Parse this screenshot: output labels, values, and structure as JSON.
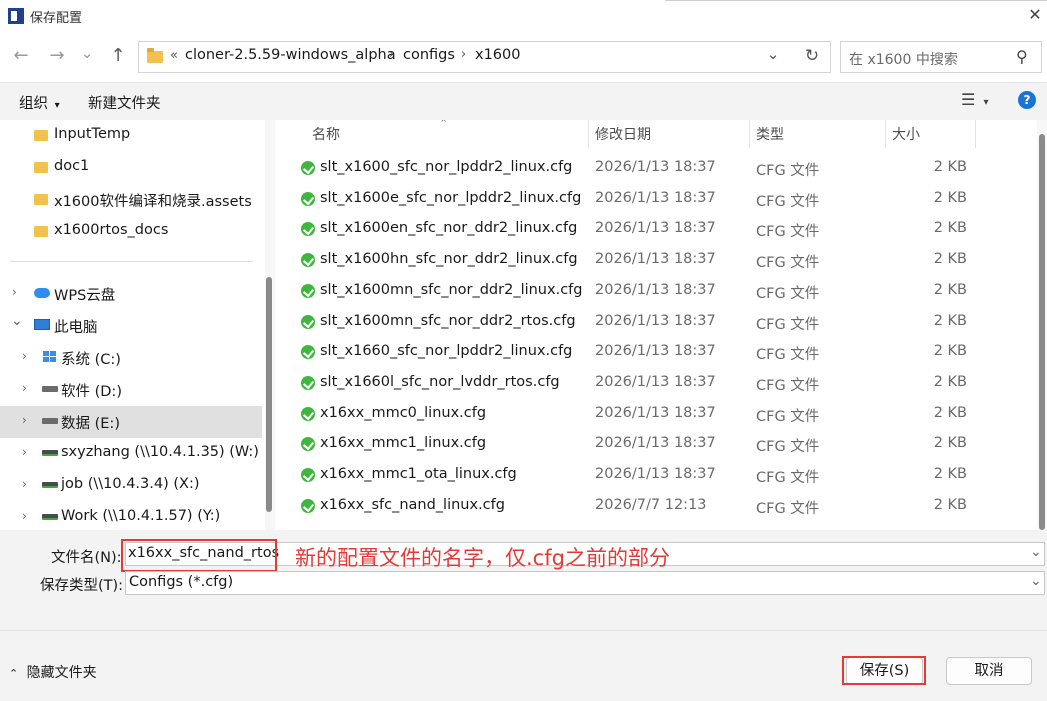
{
  "window": {
    "title": "保存配置",
    "close_glyph": "✕"
  },
  "nav": {
    "back_glyph": "←",
    "forward_glyph": "→",
    "recent_glyph": "⌄",
    "up_glyph": "↑",
    "overflow_glyph": "«",
    "breadcrumb": [
      "cloner-2.5.59-windows_alpha",
      "configs",
      "x1600"
    ],
    "crumb_sep": "›",
    "dropdown_glyph": "⌄",
    "refresh_glyph": "↻",
    "search_placeholder": "在 x1600 中搜索",
    "search_glyph": "⚲"
  },
  "commands": {
    "organize": "组织",
    "organize_caret": "▾",
    "new_folder": "新建文件夹",
    "view_glyph": "☰",
    "view_caret": "▾",
    "help_glyph": "?"
  },
  "tree": {
    "folders": [
      "InputTemp",
      "doc1",
      "x1600软件编译和烧录.assets",
      "x1600rtos_docs"
    ],
    "chev_right": "›",
    "chev_down": "⌄",
    "wps": "WPS云盘",
    "this_pc": "此电脑",
    "drives": [
      {
        "label": "系统 (C:)",
        "icon": "windows-drive-icon"
      },
      {
        "label": "软件 (D:)",
        "icon": "drive-icon"
      },
      {
        "label": "数据 (E:)",
        "icon": "drive-icon",
        "selected": true
      },
      {
        "label": "sxyzhang (\\\\10.4.1.35) (W:)",
        "icon": "network-drive-icon"
      },
      {
        "label": "job (\\\\10.4.3.4) (X:)",
        "icon": "network-drive-icon"
      },
      {
        "label": "Work (\\\\10.4.1.57) (Y:)",
        "icon": "network-drive-icon"
      }
    ]
  },
  "files": {
    "columns": {
      "name": "名称",
      "date": "修改日期",
      "type": "类型",
      "size": "大小"
    },
    "sort_glyph": "⌃",
    "rows": [
      {
        "name": "slt_x1600_sfc_nor_lpddr2_linux.cfg",
        "date": "2026/1/13 18:37",
        "type": "CFG 文件",
        "size": "2 KB"
      },
      {
        "name": "slt_x1600e_sfc_nor_lpddr2_linux.cfg",
        "date": "2026/1/13 18:37",
        "type": "CFG 文件",
        "size": "2 KB"
      },
      {
        "name": "slt_x1600en_sfc_nor_ddr2_linux.cfg",
        "date": "2026/1/13 18:37",
        "type": "CFG 文件",
        "size": "2 KB"
      },
      {
        "name": "slt_x1600hn_sfc_nor_ddr2_linux.cfg",
        "date": "2026/1/13 18:37",
        "type": "CFG 文件",
        "size": "2 KB"
      },
      {
        "name": "slt_x1600mn_sfc_nor_ddr2_linux.cfg",
        "date": "2026/1/13 18:37",
        "type": "CFG 文件",
        "size": "2 KB"
      },
      {
        "name": "slt_x1600mn_sfc_nor_ddr2_rtos.cfg",
        "date": "2026/1/13 18:37",
        "type": "CFG 文件",
        "size": "2 KB"
      },
      {
        "name": "slt_x1660_sfc_nor_lpddr2_linux.cfg",
        "date": "2026/1/13 18:37",
        "type": "CFG 文件",
        "size": "2 KB"
      },
      {
        "name": "slt_x1660l_sfc_nor_lvddr_rtos.cfg",
        "date": "2026/1/13 18:37",
        "type": "CFG 文件",
        "size": "2 KB"
      },
      {
        "name": "x16xx_mmc0_linux.cfg",
        "date": "2026/1/13 18:37",
        "type": "CFG 文件",
        "size": "2 KB"
      },
      {
        "name": "x16xx_mmc1_linux.cfg",
        "date": "2026/1/13 18:37",
        "type": "CFG 文件",
        "size": "2 KB"
      },
      {
        "name": "x16xx_mmc1_ota_linux.cfg",
        "date": "2026/1/13 18:37",
        "type": "CFG 文件",
        "size": "2 KB"
      },
      {
        "name": "x16xx_sfc_nand_linux.cfg",
        "date": "2026/7/7 12:13",
        "type": "CFG 文件",
        "size": "2 KB"
      }
    ]
  },
  "form": {
    "filename_label": "文件名(N):",
    "filename_value": "x16xx_sfc_nand_rtos",
    "filetype_label": "保存类型(T):",
    "filetype_value": "Configs (*.cfg)",
    "combo_arrow": "⌄",
    "annotation": "新的配置文件的名字，仅.cfg之前的部分"
  },
  "footer": {
    "hide_folders": "隐藏文件夹",
    "hide_caret": "⌃",
    "save": "保存(S)",
    "cancel": "取消"
  },
  "colors": {
    "accent": "#1a73d9",
    "annotation_red": "#e53935",
    "file_icon_green": "#3fb73f",
    "folder_yellow": "#f2c14e"
  }
}
